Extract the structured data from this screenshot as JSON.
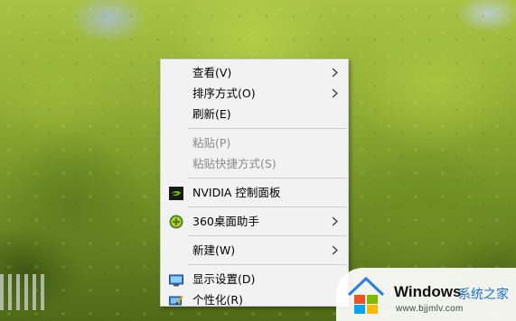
{
  "context_menu": {
    "items": [
      {
        "label": "查看(V)",
        "submenu": true,
        "enabled": true
      },
      {
        "label": "排序方式(O)",
        "submenu": true,
        "enabled": true
      },
      {
        "label": "刷新(E)",
        "submenu": false,
        "enabled": true
      },
      {
        "label": "粘贴(P)",
        "submenu": false,
        "enabled": false
      },
      {
        "label": "粘贴快捷方式(S)",
        "submenu": false,
        "enabled": false
      },
      {
        "label": "NVIDIA 控制面板",
        "submenu": false,
        "enabled": true,
        "icon": "nvidia-icon"
      },
      {
        "label": "360桌面助手",
        "submenu": true,
        "enabled": true,
        "icon": "360-assistant-icon"
      },
      {
        "label": "新建(W)",
        "submenu": true,
        "enabled": true
      },
      {
        "label": "显示设置(D)",
        "submenu": false,
        "enabled": true,
        "icon": "display-settings-icon"
      },
      {
        "label": "个性化(R)",
        "submenu": false,
        "enabled": true,
        "icon": "personalize-icon"
      }
    ]
  },
  "watermark": {
    "brand": "Windows",
    "site_name": "系统之家",
    "url": "www.bjjmlv.com"
  },
  "colors": {
    "menu_bg": "#f2f2f2",
    "disabled_text": "#8a8a8a",
    "link_blue": "#1a6fd1"
  }
}
